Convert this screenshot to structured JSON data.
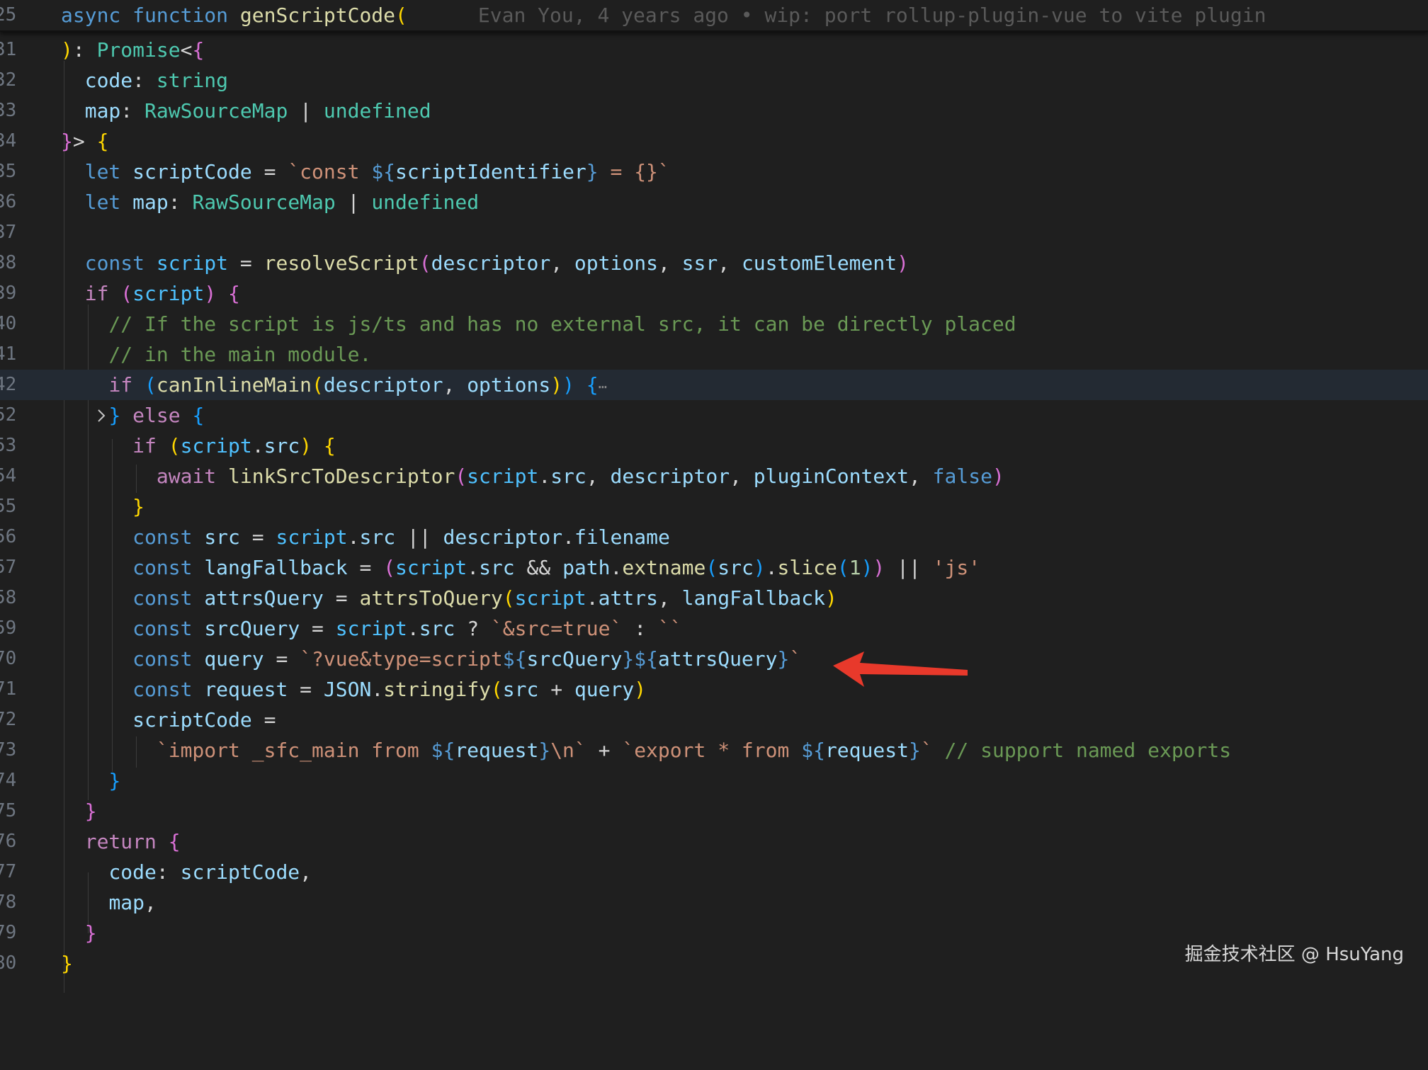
{
  "sticky_header": {
    "line_number": "25",
    "code": "async function genScriptCode(",
    "blame": "Evan You, 4 years ago • wip: port rollup-plugin-vue to vite plugin"
  },
  "lines": [
    {
      "num": "31",
      "text": "): Promise<{"
    },
    {
      "num": "32",
      "text": "  code: string"
    },
    {
      "num": "33",
      "text": "  map: RawSourceMap | undefined"
    },
    {
      "num": "34",
      "text": "}> {"
    },
    {
      "num": "35",
      "text": "  let scriptCode = `const ${scriptIdentifier} = {}`"
    },
    {
      "num": "36",
      "text": "  let map: RawSourceMap | undefined"
    },
    {
      "num": "37",
      "text": ""
    },
    {
      "num": "38",
      "text": "  const script = resolveScript(descriptor, options, ssr, customElement)"
    },
    {
      "num": "39",
      "text": "  if (script) {"
    },
    {
      "num": "40",
      "text": "    // If the script is js/ts and has no external src, it can be directly placed"
    },
    {
      "num": "41",
      "text": "    // in the main module."
    },
    {
      "num": "42",
      "text": "    if (canInlineMain(descriptor, options)) {⋯",
      "folded": true
    },
    {
      "num": "52",
      "text": "    } else {"
    },
    {
      "num": "53",
      "text": "      if (script.src) {"
    },
    {
      "num": "54",
      "text": "        await linkSrcToDescriptor(script.src, descriptor, pluginContext, false)"
    },
    {
      "num": "55",
      "text": "      }"
    },
    {
      "num": "56",
      "text": "      const src = script.src || descriptor.filename"
    },
    {
      "num": "57",
      "text": "      const langFallback = (script.src && path.extname(src).slice(1)) || 'js'"
    },
    {
      "num": "58",
      "text": "      const attrsQuery = attrsToQuery(script.attrs, langFallback)"
    },
    {
      "num": "59",
      "text": "      const srcQuery = script.src ? `&src=true` : ``"
    },
    {
      "num": "70",
      "text": "      const query = `?vue&type=script${srcQuery}${attrsQuery}`"
    },
    {
      "num": "71",
      "text": "      const request = JSON.stringify(src + query)"
    },
    {
      "num": "72",
      "text": "      scriptCode ="
    },
    {
      "num": "73",
      "text": "        `import _sfc_main from ${request}\\n` + `export * from ${request}` // support named exports"
    },
    {
      "num": "74",
      "text": "    }"
    },
    {
      "num": "75",
      "text": "  }"
    },
    {
      "num": "76",
      "text": "  return {"
    },
    {
      "num": "77",
      "text": "    code: scriptCode,"
    },
    {
      "num": "78",
      "text": "    map,"
    },
    {
      "num": "79",
      "text": "  }"
    },
    {
      "num": "80",
      "text": "}"
    }
  ],
  "annotation": {
    "arrow_color": "#e8392b",
    "points_to_line": "70"
  },
  "watermark": "掘金技术社区 @ HsuYang",
  "colors": {
    "background": "#1f1f1f",
    "highlight_line": "#232a33",
    "line_number": "#6e7681"
  }
}
